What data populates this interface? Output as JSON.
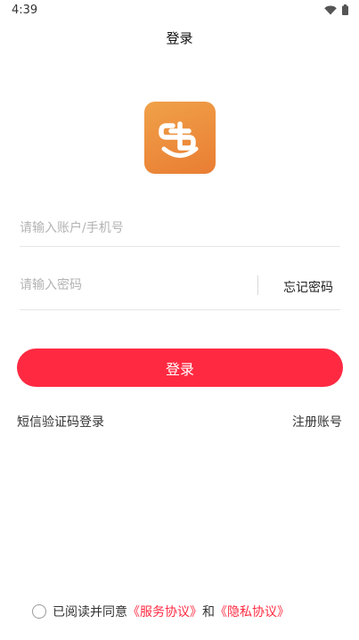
{
  "status_bar": {
    "time": "4:39",
    "icons": [
      "wifi-icon",
      "battery-icon"
    ]
  },
  "header": {
    "title": "登录"
  },
  "logo": {
    "icon": "app-logo-icon",
    "colors": {
      "gradient_top": "#f0a149",
      "gradient_bottom": "#e97d33",
      "glyph": "#ffffff"
    }
  },
  "form": {
    "account_placeholder": "请输入账户/手机号",
    "password_placeholder": "请输入密码",
    "forgot_password": "忘记密码",
    "login_button": "登录",
    "sms_login": "短信验证码登录",
    "register": "注册账号"
  },
  "agreement": {
    "prefix": "已阅读并同意",
    "service_link": "《服务协议》",
    "and": "和",
    "privacy_link": "《隐私协议》",
    "checked": false
  },
  "colors": {
    "accent": "#ff2a42",
    "divider": "#e6e6e6",
    "placeholder": "#b3b3b3"
  }
}
